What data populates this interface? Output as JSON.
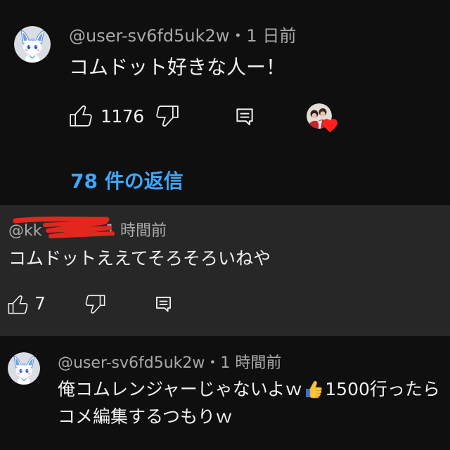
{
  "colors": {
    "background": "#0f0f0f",
    "reply_highlight_background": "#272727",
    "text_primary": "#f1f1f1",
    "text_secondary": "#aaaaaa",
    "link": "#3ea6ff",
    "creator_heart": "#ff1f1f",
    "redaction": "#e3261e"
  },
  "icons": {
    "avatar": "avatar-icon",
    "like": "thumbs-up-icon",
    "dislike": "thumbs-down-icon",
    "reply": "comment-icon",
    "creator_heart": "creator-heart-icon",
    "emoji": "thumbs-up-emoji-icon"
  },
  "top_comment": {
    "author": "@user-sv6fd5uk2w",
    "separator": "・",
    "time": "1 日前",
    "text": "コムドット好きな人ー！",
    "like_count": "1176",
    "replies_link": "78 件の返信"
  },
  "replies": [
    {
      "author": "@kk",
      "time": "1 時間前",
      "text": "コムドットええてそろそろいねや",
      "like_count": "7"
    },
    {
      "author": "@user-sv6fd5uk2w",
      "separator": "・",
      "time": "1 時間前",
      "text_line1_start": "俺コムレンジャーじゃないよｗ",
      "text_line1_end": "1500行ったら",
      "text_line2": "コメ編集するつもりｗ"
    }
  ]
}
